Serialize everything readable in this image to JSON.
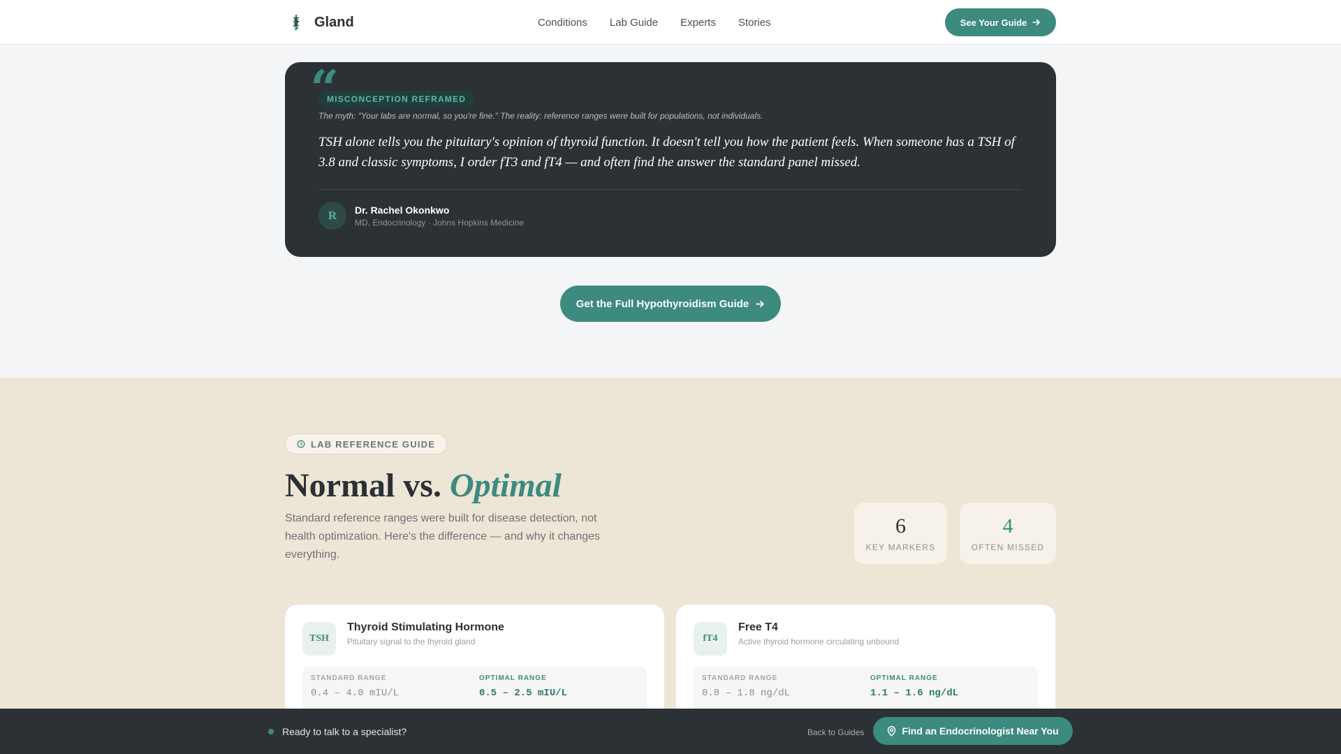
{
  "header": {
    "brand_name": "Gland",
    "brand_icon": "caduceus-icon",
    "nav": [
      "Conditions",
      "Lab Guide",
      "Experts",
      "Stories"
    ],
    "cta_label": "See Your Guide"
  },
  "quote": {
    "badge": "MISCONCEPTION REFRAMED",
    "myth": "The myth: \"Your labs are normal, so you're fine.\" The reality: reference ranges were built for populations, not individuals.",
    "text": "TSH alone tells you the pituitary's opinion of thyroid function. It doesn't tell you how the patient feels. When someone has a TSH of 3.8 and classic symptoms, I order fT3 and fT4 — and often find the answer the standard panel missed.",
    "avatar_initial": "R",
    "author_name": "Dr. Rachel Okonkwo",
    "author_role": "MD, Endocrinology · Johns Hopkins Medicine"
  },
  "guide_cta": "Get the Full Hypothyroidism Guide",
  "lab": {
    "badge": "LAB REFERENCE GUIDE",
    "title_plain": "Normal vs. ",
    "title_accent": "Optimal",
    "description": "Standard reference ranges were built for disease detection, not health optimization. Here's the difference — and why it changes everything.",
    "stats": [
      {
        "value": "6",
        "label": "KEY MARKERS"
      },
      {
        "value": "4",
        "label": "OFTEN MISSED"
      }
    ],
    "markers": [
      {
        "abbr": "TSH",
        "name": "Thyroid Stimulating Hormone",
        "subtitle": "Pituitary signal to the thyroid gland",
        "standard_label": "STANDARD RANGE",
        "standard_value": "0.4 – 4.0 mIU/L",
        "optimal_label": "OPTIMAL RANGE",
        "optimal_value": "0.5 – 2.5 mIU/L"
      },
      {
        "abbr": "fT4",
        "name": "Free T4",
        "subtitle": "Active thyroid hormone circulating unbound",
        "standard_label": "STANDARD RANGE",
        "standard_value": "0.8 – 1.8 ng/dL",
        "optimal_label": "OPTIMAL RANGE",
        "optimal_value": "1.1 – 1.6 ng/dL"
      }
    ]
  },
  "bottom_bar": {
    "prompt": "Ready to talk to a specialist?",
    "back_label": "Back to Guides",
    "cta_label": "Find an Endocrinologist Near You"
  },
  "colors": {
    "accent": "#3d8a7e",
    "dark": "#2c3136",
    "beige": "#ede5d5",
    "light_bg": "#f4f5f7"
  }
}
